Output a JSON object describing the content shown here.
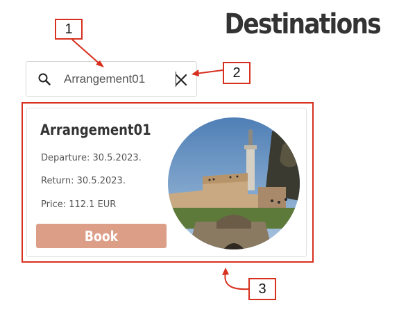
{
  "header": {
    "title": "Destinations"
  },
  "search": {
    "value": "Arrangement01",
    "icon": "search-icon",
    "clear_icon": "close-icon"
  },
  "results": [
    {
      "title": "Arrangement01",
      "departure": "Departure: 30.5.2023.",
      "return": "Return: 30.5.2023.",
      "price": "Price: 112.1 EUR",
      "book_label": "Book",
      "image": "fortress-photo"
    }
  ],
  "annotations": {
    "labels": [
      "1",
      "2",
      "3"
    ],
    "color": "#d7301f"
  },
  "colors": {
    "book_button": "#dd9e88",
    "title_text": "#333333"
  }
}
